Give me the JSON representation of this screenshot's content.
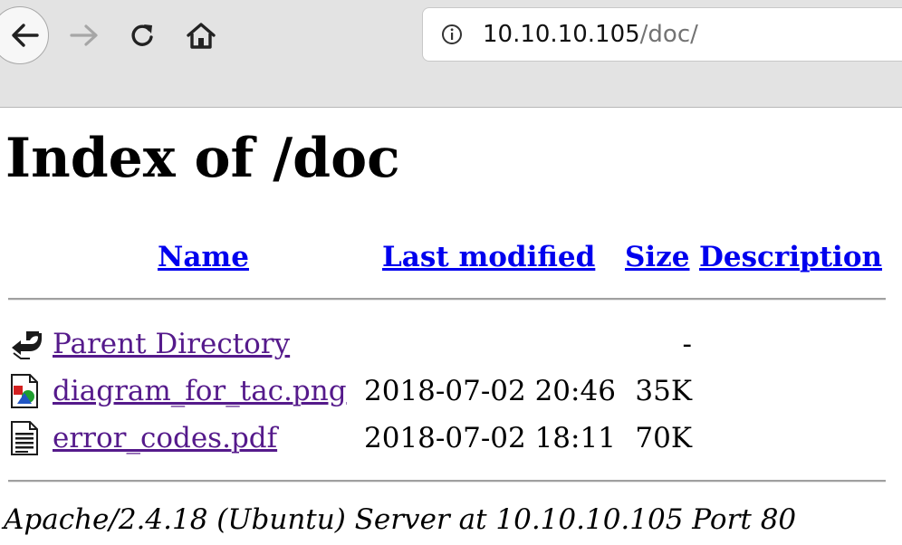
{
  "browser": {
    "url_host": "10.10.10.105",
    "url_path": "/doc/"
  },
  "page": {
    "title": "Index of /doc",
    "columns": {
      "name": "Name",
      "last_modified": "Last modified",
      "size": "Size",
      "description": "Description"
    },
    "rows": [
      {
        "name": "Parent Directory",
        "icon": "back-folder-icon",
        "modified": "",
        "size": "-"
      },
      {
        "name": "diagram_for_tac.png",
        "icon": "image-file-icon",
        "modified": "2018-07-02 20:46",
        "size": "35K"
      },
      {
        "name": "error_codes.pdf",
        "icon": "text-file-icon",
        "modified": "2018-07-02 18:11",
        "size": "70K"
      }
    ],
    "server_signature": "Apache/2.4.18 (Ubuntu) Server at 10.10.10.105 Port 80"
  },
  "colors": {
    "link": "#0000ee",
    "visited_link": "#551a8b",
    "toolbar": "#e3e3e3"
  }
}
